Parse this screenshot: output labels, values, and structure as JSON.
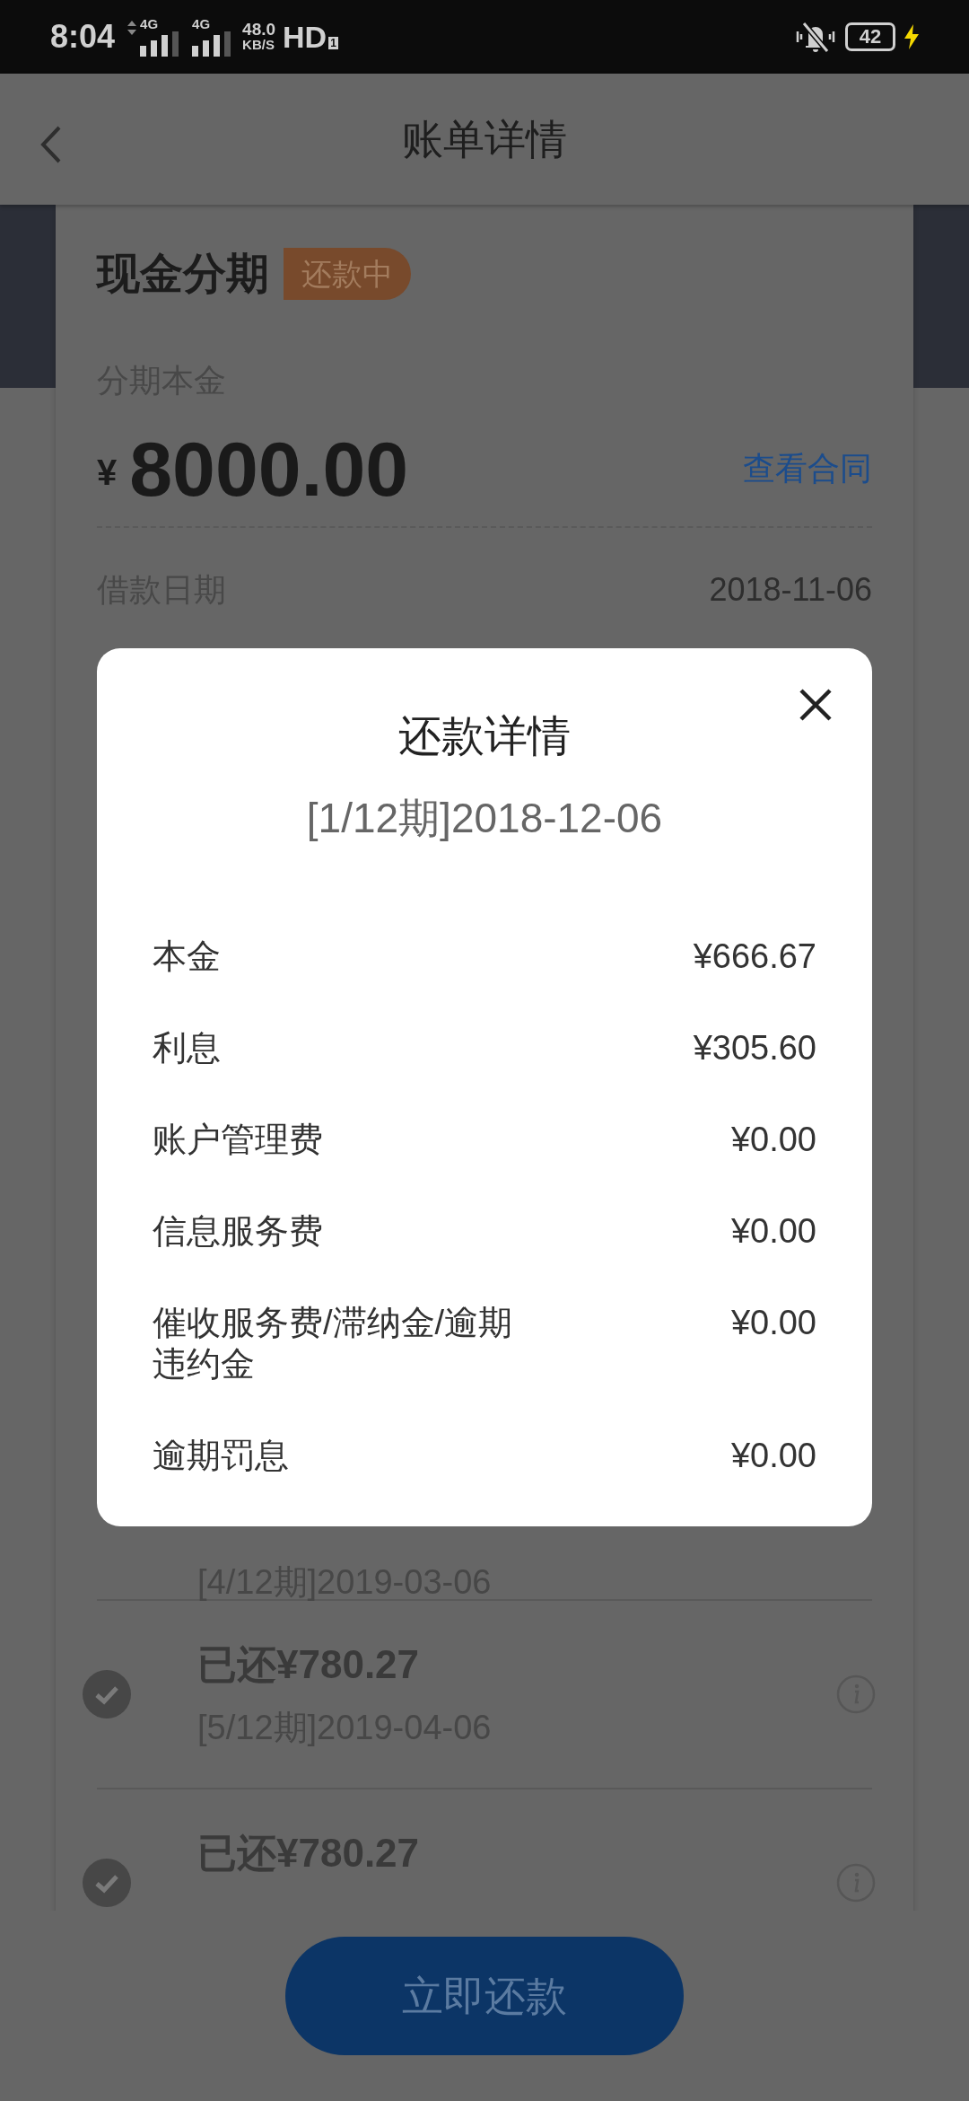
{
  "status_bar": {
    "time": "8:04",
    "network_1": "4G",
    "network_2": "4G",
    "speed_value": "48.0",
    "speed_unit": "KB/S",
    "hd": "HD",
    "hd_sub": "1",
    "battery": "42"
  },
  "header": {
    "title": "账单详情"
  },
  "loan": {
    "title": "现金分期",
    "status_tag": "还款中",
    "principal_label": "分期本金",
    "currency": "¥",
    "principal": "8000.00",
    "contract_link": "查看合同",
    "date_label": "借款日期",
    "date_value": "2018-11-06"
  },
  "installments": [
    {
      "period": "[4/12期]2019-03-06"
    },
    {
      "amount": "已还¥780.27",
      "period": "[5/12期]2019-04-06",
      "paid": true
    },
    {
      "amount": "已还¥780.27",
      "paid": true
    }
  ],
  "modal": {
    "title": "还款详情",
    "subtitle": "[1/12期]2018-12-06",
    "items": [
      {
        "label": "本金",
        "value": "¥666.67"
      },
      {
        "label": "利息",
        "value": "¥305.60"
      },
      {
        "label": "账户管理费",
        "value": "¥0.00"
      },
      {
        "label": "信息服务费",
        "value": "¥0.00"
      },
      {
        "label": "催收服务费/滞纳金/逾期违约金",
        "value": "¥0.00"
      },
      {
        "label": "逾期罚息",
        "value": "¥0.00"
      }
    ]
  },
  "footer": {
    "button": "立即还款"
  }
}
